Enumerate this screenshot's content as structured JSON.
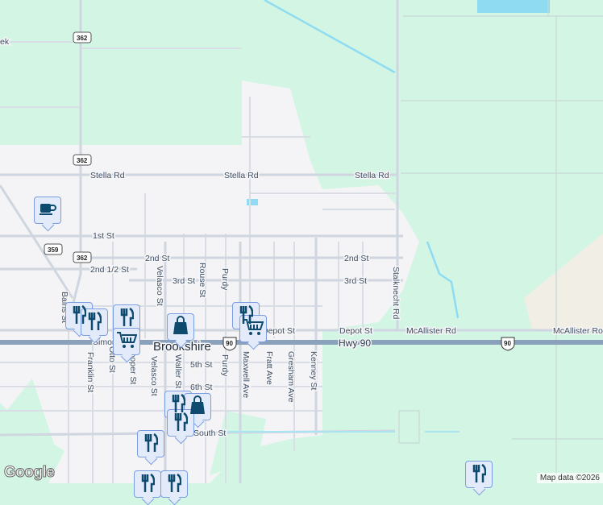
{
  "map": {
    "town": "Brookshire",
    "highway": "Hwy 90",
    "shields": {
      "sh362": "362",
      "sh359": "359",
      "us90": "90"
    },
    "streets": {
      "stella": "Stella Rd",
      "first": "1st St",
      "second": "2nd St",
      "second_half": "2nd 1/2 St",
      "third": "3rd St",
      "velasco": "Velasco St",
      "rouse": "Rouse St",
      "purdy": "Purdy",
      "depot": "Depot St",
      "mcallister": "McAllister Rd",
      "mcallister_cut": "McAllister Ro",
      "stalknecht": "Stalknecht Rd",
      "fifth": "5th St",
      "sixth": "6th St",
      "waller": "Waller St",
      "franklin": "Franklin St",
      "otto": "Otto St",
      "cooper": "Cooper St",
      "maxwell": "Maxwell Ave",
      "fratt": "Fratt Ave",
      "gresham": "Gresham Ave",
      "kenney": "Kenney St",
      "south": "South St",
      "bains": "Bains St",
      "simonton": "Simonton St",
      "creek": "ek"
    },
    "markers": [
      {
        "type": "coffee-icon"
      },
      {
        "type": "restaurant-icon"
      },
      {
        "type": "restaurant-icon"
      },
      {
        "type": "restaurant-icon"
      },
      {
        "type": "shopping-cart-icon"
      },
      {
        "type": "shopping-bag-icon"
      },
      {
        "type": "restaurant-icon"
      },
      {
        "type": "shopping-cart-icon"
      },
      {
        "type": "restaurant-icon"
      },
      {
        "type": "shopping-bag-icon"
      },
      {
        "type": "restaurant-icon"
      },
      {
        "type": "restaurant-icon"
      },
      {
        "type": "restaurant-icon"
      },
      {
        "type": "restaurant-icon"
      },
      {
        "type": "restaurant-icon"
      }
    ],
    "attribution": "Map data ©2026",
    "logo": "Google"
  },
  "colors": {
    "park": "#d3f6e4",
    "town": "#f4f3f5",
    "road": "#d5dbe5",
    "highway": "#8aa0bb",
    "water": "#8fdcf2",
    "marker": "#0d4a6e"
  }
}
